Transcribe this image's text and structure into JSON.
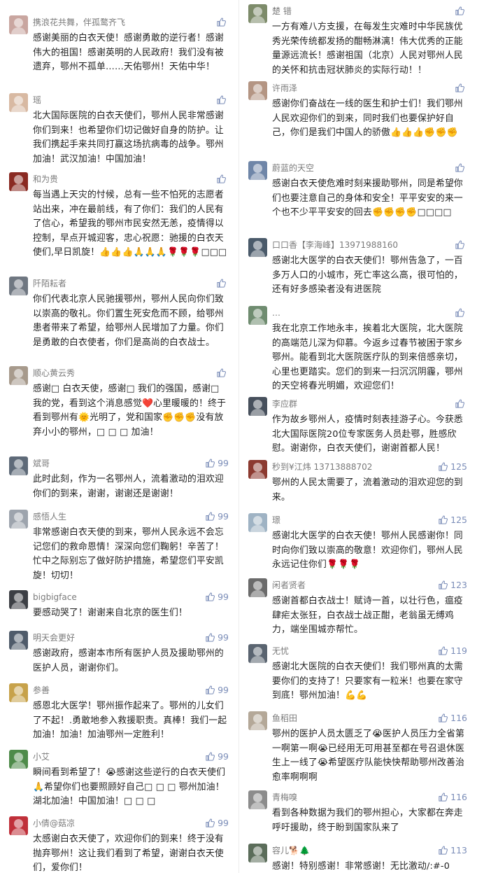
{
  "colors": {
    "accent": "#7b8db8",
    "name": "#7a7a7a",
    "text": "#1f1f1f"
  },
  "thumb_icon": "thumbs-up-icon",
  "left_comments": [
    {
      "name": "携浪花共舞，伴孤鹜齐飞",
      "likes": "",
      "text": "感谢美丽的白衣天使！感谢勇敢的逆行者！感谢伟大的祖国！感谢英明的人民政府！我们没有被遗弃，鄂州不孤单……天佑鄂州！天佑中华！"
    },
    {
      "name": "瑶",
      "likes": "",
      "text": "北大国际医院的白衣天使们，鄂州人民非常感谢你们到来！也希望你们切记做好自身的防护。让我们携起手来共同打赢这场抗病毒的战争。鄂州加油！武汉加油！中国加油！"
    },
    {
      "name": "和为贵",
      "likes": "",
      "text": "每当遇上天灾的忖候，总有一些不怕死的志愿者站出来，冲在最前线，有了你们：我们的人民有了信心，希望我的鄂州市民安然无恙，疫情得以控制，早点开城迎客，忠心祝愿：驰援的白衣天使们,早日凯旋！👍👍👍🙏🙏🙏🌹🌹🌹□□□"
    },
    {
      "name": "阡陌耘者",
      "likes": "",
      "text": "你们代表北京人民驰援鄂州，鄂州人民向你们致以崇高的敬礼。你们置生死安危而不顾，给鄂州患者带来了希望，给鄂州人民增加了力量。你们是勇敢的白衣使者，你们是高尚的白衣战士。"
    },
    {
      "name": "顺心黄云秀",
      "likes": "",
      "text": "感谢□ 白衣天使，感谢□ 我们的强国，感谢□ 我的党，看到这个消息感觉❤️心里暖暖的！终于看到鄂州有🌞光明了，党和国家✊✊✊没有放弃小小的鄂州，□ □ □ 加油！"
    },
    {
      "name": "斌哥",
      "likes": "99",
      "text": "此时此刻，作为一名鄂州人，流着激动的泪欢迎你们的到来，谢谢，谢谢还是谢谢！"
    },
    {
      "name": "感悟人生",
      "likes": "99",
      "text": "非常感谢白衣天使的到来，鄂州人民永远不会忘记您们的救命恩情！深深向您们鞠躬！辛苦了！忙中之际别忘了做好防护措施，希望您们平安凯旋！切切！"
    },
    {
      "name": "bigbigface",
      "likes": "99",
      "text": "要感动哭了！谢谢来自北京的医生们！"
    },
    {
      "name": "明天会更好",
      "likes": "99",
      "text": "感谢政府，感谢本市所有医护人员及援助鄂州的医护人员，谢谢你们。"
    },
    {
      "name": "参善",
      "likes": "99",
      "text": "感恩北大医学！鄂州振作起来了。鄂州的儿女们了不起！.勇敢地参入救援职责。真棒！我们一起加油！加油！加油鄂州一定胜利！"
    },
    {
      "name": "小艾",
      "likes": "99",
      "text": "瞬间看到希望了！😭感谢这些逆行的白衣天使们🙏希望你们也要照顾好自己□ □ □ 鄂州加油！湖北加油！中国加油！□ □ □"
    },
    {
      "name": "小倩@菇凉",
      "likes": "99",
      "text": "太感谢白衣天使了，欢迎你们的到来！终于没有抛弃鄂州！这让我们看到了希望，谢谢白衣天使们，爱你们！"
    }
  ],
  "right_comments": [
    {
      "name": "楚 错",
      "likes": "",
      "text": "一方有难八方支援，在每发生灾难时中华民族优秀光荣传统都发扬的酣畅淋漓！伟大优秀的正能量源远流长！感谢祖国（北京）人民对鄂州人民的关怀和抗击冠状肺炎的实际行动！！"
    },
    {
      "name": "许雨泽",
      "likes": "",
      "text": "感谢你们奋战在一线的医生和护士们！我们鄂州人民欢迎你们的到来，同时我们也要保护好自己，你们是我们中国人的骄傲👍👍👍✊✊✊"
    },
    {
      "name": "蔚蓝的天空",
      "likes": "",
      "text": "感谢白衣天使危难时刻来援助鄂州，同是希望你们也要注意自己的身体和安全！平平安安的来一个也不少平平安安的回去✊✊✊✊□□□□"
    },
    {
      "name": "口口香【李海峰】13971988160",
      "likes": "",
      "text": "感谢北大医学的白衣天使们！鄂州告急了，一百多万人口的小城市，死亡率这么高，很可怕的，还有好多感染者没有进医院"
    },
    {
      "name": "…",
      "likes": "",
      "text": "我在北京工作地永丰，挨着北大医院，北大医院的高端范儿深为仰慕。今返乡过春节被困于家乡鄂州。能看到北大医院医疗队的到来倍感亲切，心里也更踏实。您们的到来一扫沉沉阴霾，鄂州的天空将春光明媚，欢迎您们！"
    },
    {
      "name": "李应群",
      "likes": "",
      "text": "作为故乡鄂州人，疫情时刻表挂游子心。今获悉北大国际医院20位专家医务人员赴鄂，胜感欣慰。谢谢你，白衣天使们，谢谢首都人民！"
    },
    {
      "name": "秒到¥江炜 13713888702",
      "likes": "125",
      "text": "鄂州的人民太需要了，流着激动的泪欢迎您的到来。"
    },
    {
      "name": "璟",
      "likes": "125",
      "text": "感谢北大医学的白衣天使！鄂州人民感谢你！同时向你们致以崇高的敬意！欢迎你们，鄂州人民永远记住你们🌹🌹🌹"
    },
    {
      "name": "闲者贤者",
      "likes": "123",
      "text": "感谢首都白衣战士！赋诗一首，以壮行色，瘟疫肆疟太张狂，白衣战士战正酣，老翁虽无缚鸡力，端坐围城亦帮忙。"
    },
    {
      "name": "无忧",
      "likes": "119",
      "text": "感谢北大医院的白衣天使们！我们鄂州真的太需要你们的支持了！只要家有一粒米！也要在家守到底！鄂州加油！💪💪"
    },
    {
      "name": "鱼稻田",
      "likes": "116",
      "text": "鄂州的医护人员太匮乏了😭医护人员压力全省第一啊第一啊😭已经用无可用甚至都在号召退休医生上一线了😭希望医疗队能快快帮助鄂州改善治愈率啊啊啊"
    },
    {
      "name": "青梅嗅",
      "likes": "116",
      "text": "看到各种数据为我们的鄂州担心，大家都在奔走呼吁援助，终于盼到国家队来了"
    },
    {
      "name": "容儿🐕🌲",
      "likes": "113",
      "text": "感谢！特别感谢！非常感谢！无比激动/:#-0"
    }
  ]
}
